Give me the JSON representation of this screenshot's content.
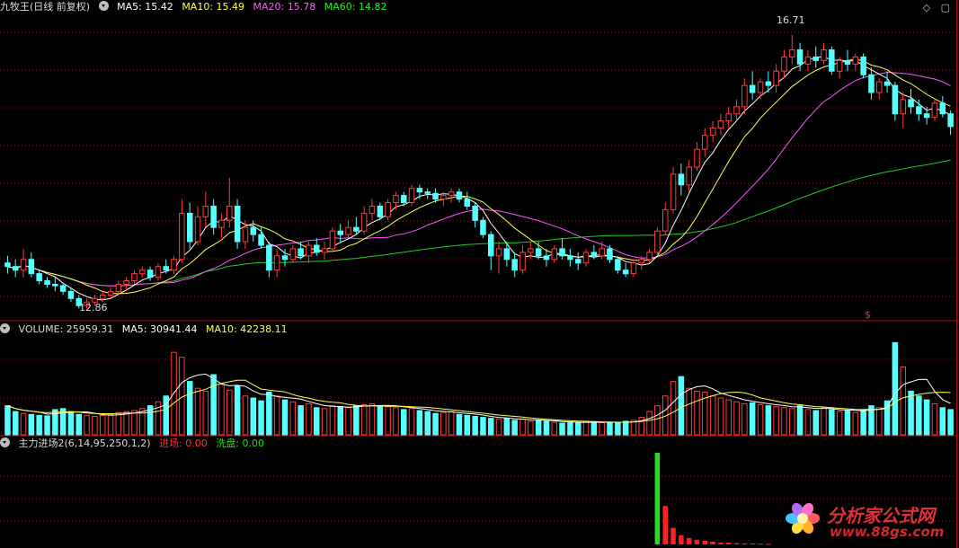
{
  "header_main": {
    "title": "九牧王(日线 前复权)",
    "ma5": "MA5: 15.42",
    "ma10": "MA10: 15.49",
    "ma20": "MA20: 15.78",
    "ma60": "MA60: 14.82"
  },
  "header_volume": {
    "title": "VOLUME: 25959.31",
    "ma5": "MA5: 30941.44",
    "ma10": "MA10: 42238.11"
  },
  "header_indicator": {
    "title": "主力进场2(6,14,95,250,1,2)",
    "entry": "进场: 0.00",
    "wash": "洗盘: 0.00"
  },
  "annotations": {
    "high": "16.71",
    "low": "12.86",
    "marker": "$"
  },
  "watermark": {
    "brand": "分析家公式网",
    "url": "www.88gs.com"
  },
  "colors": {
    "up": "#ff3c3c",
    "down": "#54ffff",
    "ma5": "#ffffff",
    "ma10": "#ffff55",
    "ma20": "#ff55ff",
    "ma60": "#22cc22",
    "entry": "#ff2020",
    "wash": "#22dd22"
  },
  "chart_data": {
    "type": "candlestick",
    "price_axis": {
      "ylim": [
        12.7,
        17.0
      ]
    },
    "volume_axis": {
      "ylim": [
        0,
        100000
      ]
    },
    "candles": [
      [
        13.5,
        13.6,
        13.35,
        13.45
      ],
      [
        13.45,
        13.55,
        13.3,
        13.4
      ],
      [
        13.4,
        13.7,
        13.3,
        13.55
      ],
      [
        13.55,
        13.65,
        13.3,
        13.35
      ],
      [
        13.35,
        13.4,
        13.2,
        13.25
      ],
      [
        13.25,
        13.3,
        13.15,
        13.2
      ],
      [
        13.2,
        13.3,
        13.1,
        13.18
      ],
      [
        13.18,
        13.2,
        13.05,
        13.1
      ],
      [
        13.1,
        13.15,
        12.95,
        13.0
      ],
      [
        13.0,
        13.05,
        12.86,
        12.9
      ],
      [
        12.9,
        13.0,
        12.86,
        12.95
      ],
      [
        12.95,
        13.05,
        12.9,
        13.0
      ],
      [
        13.0,
        13.1,
        12.95,
        13.05
      ],
      [
        13.05,
        13.15,
        13.0,
        13.1
      ],
      [
        13.1,
        13.25,
        13.05,
        13.2
      ],
      [
        13.2,
        13.3,
        13.1,
        13.25
      ],
      [
        13.25,
        13.4,
        13.2,
        13.35
      ],
      [
        13.35,
        13.45,
        13.3,
        13.4
      ],
      [
        13.4,
        13.45,
        13.25,
        13.3
      ],
      [
        13.3,
        13.5,
        13.25,
        13.45
      ],
      [
        13.45,
        13.55,
        13.35,
        13.4
      ],
      [
        13.4,
        13.6,
        13.35,
        13.55
      ],
      [
        13.55,
        14.4,
        13.5,
        14.2
      ],
      [
        14.2,
        14.35,
        13.7,
        13.8
      ],
      [
        13.8,
        14.3,
        13.75,
        14.15
      ],
      [
        14.15,
        14.5,
        14.0,
        14.3
      ],
      [
        14.3,
        14.4,
        13.9,
        14.0
      ],
      [
        14.0,
        14.2,
        13.85,
        14.1
      ],
      [
        14.1,
        14.7,
        14.0,
        14.3
      ],
      [
        14.3,
        14.4,
        13.7,
        13.8
      ],
      [
        13.8,
        14.1,
        13.7,
        14.0
      ],
      [
        14.0,
        14.1,
        13.8,
        13.9
      ],
      [
        13.9,
        14.0,
        13.7,
        13.75
      ],
      [
        13.75,
        13.8,
        13.3,
        13.4
      ],
      [
        13.4,
        13.7,
        13.3,
        13.6
      ],
      [
        13.6,
        13.7,
        13.45,
        13.55
      ],
      [
        13.55,
        13.75,
        13.5,
        13.7
      ],
      [
        13.7,
        13.8,
        13.55,
        13.6
      ],
      [
        13.6,
        13.8,
        13.5,
        13.75
      ],
      [
        13.75,
        13.85,
        13.6,
        13.65
      ],
      [
        13.65,
        13.8,
        13.55,
        13.7
      ],
      [
        13.7,
        14.0,
        13.65,
        13.95
      ],
      [
        13.95,
        14.05,
        13.8,
        13.9
      ],
      [
        13.9,
        14.1,
        13.85,
        14.0
      ],
      [
        14.0,
        14.15,
        13.9,
        13.95
      ],
      [
        13.95,
        14.3,
        13.9,
        14.2
      ],
      [
        14.2,
        14.4,
        14.1,
        14.3
      ],
      [
        14.3,
        14.35,
        14.1,
        14.15
      ],
      [
        14.15,
        14.4,
        14.1,
        14.35
      ],
      [
        14.35,
        14.5,
        14.25,
        14.45
      ],
      [
        14.45,
        14.5,
        14.3,
        14.35
      ],
      [
        14.35,
        14.6,
        14.3,
        14.55
      ],
      [
        14.55,
        14.6,
        14.4,
        14.5
      ],
      [
        14.5,
        14.55,
        14.4,
        14.48
      ],
      [
        14.48,
        14.55,
        14.35,
        14.4
      ],
      [
        14.4,
        14.5,
        14.3,
        14.45
      ],
      [
        14.45,
        14.55,
        14.35,
        14.5
      ],
      [
        14.5,
        14.55,
        14.35,
        14.4
      ],
      [
        14.4,
        14.5,
        14.25,
        14.3
      ],
      [
        14.3,
        14.35,
        14.0,
        14.1
      ],
      [
        14.1,
        14.15,
        13.85,
        13.9
      ],
      [
        13.9,
        13.95,
        13.4,
        13.6
      ],
      [
        13.6,
        13.8,
        13.35,
        13.7
      ],
      [
        13.7,
        13.8,
        13.45,
        13.55
      ],
      [
        13.55,
        13.65,
        13.3,
        13.4
      ],
      [
        13.4,
        13.75,
        13.35,
        13.65
      ],
      [
        13.65,
        13.8,
        13.55,
        13.7
      ],
      [
        13.7,
        13.8,
        13.55,
        13.6
      ],
      [
        13.6,
        13.7,
        13.45,
        13.55
      ],
      [
        13.55,
        13.75,
        13.5,
        13.7
      ],
      [
        13.7,
        13.85,
        13.55,
        13.6
      ],
      [
        13.6,
        13.7,
        13.45,
        13.55
      ],
      [
        13.55,
        13.65,
        13.4,
        13.5
      ],
      [
        13.5,
        13.7,
        13.45,
        13.65
      ],
      [
        13.65,
        13.75,
        13.55,
        13.6
      ],
      [
        13.6,
        13.8,
        13.55,
        13.7
      ],
      [
        13.7,
        13.75,
        13.5,
        13.55
      ],
      [
        13.55,
        13.6,
        13.35,
        13.4
      ],
      [
        13.4,
        13.5,
        13.3,
        13.35
      ],
      [
        13.35,
        13.55,
        13.3,
        13.5
      ],
      [
        13.5,
        13.6,
        13.4,
        13.55
      ],
      [
        13.55,
        13.7,
        13.5,
        13.65
      ],
      [
        13.65,
        14.0,
        13.6,
        13.95
      ],
      [
        13.95,
        14.35,
        13.9,
        14.25
      ],
      [
        14.25,
        14.85,
        14.2,
        14.75
      ],
      [
        14.75,
        14.9,
        14.45,
        14.6
      ],
      [
        14.6,
        14.95,
        14.5,
        14.85
      ],
      [
        14.85,
        15.2,
        14.8,
        15.1
      ],
      [
        15.1,
        15.4,
        15.0,
        15.3
      ],
      [
        15.3,
        15.5,
        15.2,
        15.4
      ],
      [
        15.4,
        15.6,
        15.3,
        15.5
      ],
      [
        15.5,
        15.7,
        15.4,
        15.6
      ],
      [
        15.6,
        15.8,
        15.5,
        15.7
      ],
      [
        15.7,
        16.1,
        15.6,
        16.0
      ],
      [
        16.0,
        16.2,
        15.8,
        15.9
      ],
      [
        15.9,
        16.1,
        15.8,
        16.05
      ],
      [
        16.05,
        16.2,
        15.9,
        16.0
      ],
      [
        16.0,
        16.3,
        15.9,
        16.2
      ],
      [
        16.2,
        16.5,
        16.1,
        16.4
      ],
      [
        16.4,
        16.71,
        16.3,
        16.5
      ],
      [
        16.5,
        16.6,
        16.2,
        16.3
      ],
      [
        16.3,
        16.5,
        16.2,
        16.4
      ],
      [
        16.4,
        16.55,
        16.25,
        16.35
      ],
      [
        16.35,
        16.6,
        16.3,
        16.5
      ],
      [
        16.5,
        16.55,
        16.15,
        16.2
      ],
      [
        16.2,
        16.4,
        16.1,
        16.35
      ],
      [
        16.35,
        16.5,
        16.2,
        16.3
      ],
      [
        16.3,
        16.45,
        16.2,
        16.4
      ],
      [
        16.4,
        16.45,
        16.1,
        16.15
      ],
      [
        16.15,
        16.25,
        15.8,
        15.9
      ],
      [
        15.9,
        16.1,
        15.8,
        16.05
      ],
      [
        16.05,
        16.2,
        15.9,
        16.0
      ],
      [
        16.0,
        16.05,
        15.5,
        15.6
      ],
      [
        15.6,
        15.9,
        15.4,
        15.8
      ],
      [
        15.8,
        15.95,
        15.6,
        15.7
      ],
      [
        15.7,
        15.8,
        15.5,
        15.6
      ],
      [
        15.6,
        15.7,
        15.45,
        15.55
      ],
      [
        15.55,
        15.8,
        15.5,
        15.75
      ],
      [
        15.75,
        15.85,
        15.55,
        15.6
      ],
      [
        15.6,
        15.65,
        15.3,
        15.42
      ]
    ],
    "volume": [
      30000,
      24000,
      22000,
      21000,
      20000,
      19500,
      26000,
      27000,
      24000,
      21000,
      20000,
      19000,
      20000,
      21000,
      23000,
      24000,
      25000,
      27000,
      30000,
      34000,
      40000,
      85000,
      80000,
      55000,
      48000,
      45000,
      62000,
      52000,
      46000,
      50000,
      40000,
      38000,
      35000,
      44000,
      40000,
      36000,
      34000,
      30000,
      32000,
      28000,
      27000,
      30000,
      29000,
      28000,
      30000,
      31000,
      32000,
      30000,
      29000,
      28000,
      26000,
      27000,
      25000,
      24000,
      22000,
      23000,
      24000,
      21000,
      20000,
      19000,
      18000,
      17000,
      16000,
      17000,
      15000,
      16000,
      14000,
      15000,
      14000,
      13000,
      12000,
      12500,
      13000,
      14000,
      13500,
      12500,
      12000,
      13000,
      14000,
      15000,
      18000,
      24000,
      30000,
      40000,
      55000,
      60000,
      48000,
      45000,
      44000,
      40000,
      38000,
      36000,
      34000,
      32000,
      33000,
      31000,
      30000,
      29000,
      28000,
      27000,
      30000,
      26000,
      25000,
      28000,
      26000,
      24000,
      25000,
      23000,
      26000,
      30000,
      28000,
      35000,
      95000,
      70000,
      45000,
      40000,
      36000,
      32000,
      28000,
      26000
    ],
    "indicator": {
      "series_name": "进场",
      "values": [
        100,
        42,
        18,
        10,
        7,
        5,
        4,
        3,
        2,
        2,
        1.5,
        1.2,
        1,
        0.8,
        0.6
      ]
    }
  }
}
